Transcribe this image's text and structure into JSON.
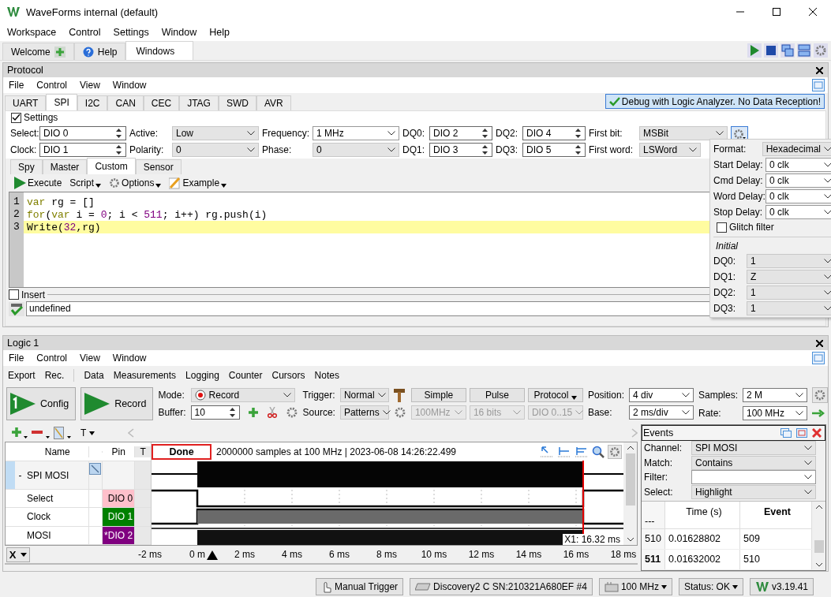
{
  "window": {
    "title": "WaveForms internal (default)"
  },
  "menu": [
    "Workspace",
    "Control",
    "Settings",
    "Window",
    "Help"
  ],
  "workspace_tabs": [
    {
      "label": "Welcome",
      "selected": false,
      "kind": "add"
    },
    {
      "label": "Help",
      "selected": false,
      "kind": "help"
    },
    {
      "label": "Windows",
      "selected": true,
      "kind": "plain"
    }
  ],
  "protocol": {
    "title": "Protocol",
    "menu": [
      "File",
      "Control",
      "View",
      "Window"
    ],
    "tabs": [
      {
        "label": "UART",
        "selected": false
      },
      {
        "label": "SPI",
        "selected": true
      },
      {
        "label": "I2C",
        "selected": false
      },
      {
        "label": "CAN",
        "selected": false
      },
      {
        "label": "CEC",
        "selected": false
      },
      {
        "label": "JTAG",
        "selected": false
      },
      {
        "label": "SWD",
        "selected": false
      },
      {
        "label": "AVR",
        "selected": false
      }
    ],
    "notice": "Debug with Logic Analyzer. No Data Reception!",
    "settings": {
      "label": "Settings",
      "checked": true,
      "columns": [
        [
          {
            "label": "Select:",
            "value": "DIO 0",
            "kind": "spin"
          },
          {
            "label": "Clock:",
            "value": "DIO 1",
            "kind": "spin"
          }
        ],
        [
          {
            "label": "Active:",
            "value": "Low",
            "kind": "list"
          },
          {
            "label": "Polarity:",
            "value": "0",
            "kind": "list"
          }
        ],
        [
          {
            "label": "Frequency:",
            "value": "1 MHz",
            "kind": "combo"
          },
          {
            "label": "Phase:",
            "value": "0",
            "kind": "list"
          }
        ],
        [
          {
            "label": "DQ0:",
            "value": "DIO 2",
            "kind": "spin"
          },
          {
            "label": "DQ1:",
            "value": "DIO 3",
            "kind": "spin"
          }
        ],
        [
          {
            "label": "DQ2:",
            "value": "DIO 4",
            "kind": "spin"
          },
          {
            "label": "DQ3:",
            "value": "DIO 5",
            "kind": "spin"
          }
        ],
        [
          {
            "label": "First bit:",
            "value": "MSBit",
            "kind": "list"
          },
          {
            "label": "First word:",
            "value": "LSWord",
            "kind": "list"
          }
        ]
      ]
    },
    "subtabs": [
      {
        "label": "Spy",
        "selected": false
      },
      {
        "label": "Master",
        "selected": false
      },
      {
        "label": "Custom",
        "selected": true
      },
      {
        "label": "Sensor",
        "selected": false
      }
    ],
    "toolbar": [
      {
        "label": "Execute",
        "kind": "run"
      },
      {
        "label": "Script",
        "kind": "menu"
      },
      {
        "label": "Options",
        "kind": "gear"
      },
      {
        "label": "Example",
        "kind": "pencil"
      }
    ],
    "code": [
      {
        "number": "1",
        "current": false,
        "tokens": [
          {
            "text": "var",
            "kind": "keyword"
          },
          {
            "text": " rg = []",
            "kind": "plain"
          }
        ]
      },
      {
        "number": "2",
        "current": false,
        "tokens": [
          {
            "text": "for",
            "kind": "keyword"
          },
          {
            "text": "(",
            "kind": "plain"
          },
          {
            "text": "var",
            "kind": "keyword"
          },
          {
            "text": " i = ",
            "kind": "plain"
          },
          {
            "text": "0",
            "kind": "number"
          },
          {
            "text": "; i < ",
            "kind": "plain"
          },
          {
            "text": "511",
            "kind": "number"
          },
          {
            "text": "; i++) rg.push(i)",
            "kind": "plain"
          }
        ]
      },
      {
        "number": "3",
        "current": true,
        "tokens": [
          {
            "text": "Write(",
            "kind": "plain"
          },
          {
            "text": "32",
            "kind": "number"
          },
          {
            "text": ",rg)",
            "kind": "plain"
          }
        ]
      }
    ],
    "insert": {
      "label": "Insert",
      "checked": false
    },
    "output": {
      "value": "undefined"
    },
    "popup": {
      "rows": [
        {
          "label": "Format:",
          "value": "Hexadecimal",
          "kind": "list"
        },
        {
          "label": "Start Delay:",
          "value": "0 clk",
          "kind": "combo"
        },
        {
          "label": "Cmd Delay:",
          "value": "0 clk",
          "kind": "combo"
        },
        {
          "label": "Word Delay:",
          "value": "0 clk",
          "kind": "combo"
        },
        {
          "label": "Stop Delay:",
          "value": "0 clk",
          "kind": "combo"
        }
      ],
      "glitch": {
        "label": "Glitch filter",
        "checked": false
      },
      "initial_label": "Initial",
      "initial": [
        {
          "label": "DQ0:",
          "value": "1"
        },
        {
          "label": "DQ1:",
          "value": "Z"
        },
        {
          "label": "DQ2:",
          "value": "1"
        },
        {
          "label": "DQ3:",
          "value": "1"
        }
      ]
    }
  },
  "logic": {
    "title": "Logic 1",
    "menu": [
      "File",
      "Control",
      "View",
      "Window"
    ],
    "toolbar": [
      [
        "Export",
        "Rec."
      ],
      [
        "Data",
        "Measurements",
        "Logging",
        "Counter",
        "Cursors",
        "Notes"
      ]
    ],
    "run_buttons": [
      {
        "label": "Config",
        "kind": "config"
      },
      {
        "label": "Record",
        "kind": "record"
      }
    ],
    "mode": {
      "label": "Mode:",
      "value": "Record"
    },
    "buffer": {
      "label": "Buffer:",
      "value": "10"
    },
    "trigger": {
      "label": "Trigger:",
      "value": "Normal"
    },
    "source": {
      "label": "Source:",
      "value": "Patterns"
    },
    "trigger_buttons": [
      {
        "label": "Simple",
        "kind": "plain"
      },
      {
        "label": "Pulse",
        "kind": "plain"
      },
      {
        "label": "Protocol",
        "kind": "menu"
      }
    ],
    "trigger_fields": [
      {
        "value": "100MHz",
        "disabled": true
      },
      {
        "value": "16 bits",
        "disabled": true
      },
      {
        "value": "DIO 0..15",
        "disabled": true
      }
    ],
    "timebase": [
      [
        {
          "label": "Position:",
          "value": "4 div"
        },
        {
          "label": "Base:",
          "value": "2 ms/div"
        }
      ],
      [
        {
          "label": "Samples:",
          "value": "2 M"
        },
        {
          "label": "Rate:",
          "value": "100 MHz"
        }
      ]
    ],
    "signal_tools": [
      "T"
    ],
    "header": {
      "name": "Name",
      "pin": "Pin",
      "t": "T",
      "status": "Done",
      "info": "2000000 samples at 100 MHz | 2023-06-08 14:26:22.499"
    },
    "signals": [
      {
        "toggle": "-",
        "name": "SPI MOSI",
        "kind": "bus",
        "selected": true
      },
      {
        "name": "Select",
        "pin": "DIO 0",
        "color": "#ffc0cb",
        "kind": "signal",
        "selected": false
      },
      {
        "name": "Clock",
        "pin": "DIO 1",
        "color": "#008000",
        "kind": "signal",
        "selected": false
      },
      {
        "name": "MOSI",
        "pin": "*DIO 2",
        "color": "#800080",
        "kind": "signal",
        "selected": false
      }
    ],
    "axis": {
      "label": "X",
      "ticks": [
        "-2 ms",
        "0 m",
        "2 ms",
        "4 ms",
        "6 ms",
        "8 ms",
        "10 ms",
        "12 ms",
        "14 ms",
        "16 ms",
        "18 ms"
      ],
      "cursor": "X1: 16.32 ms"
    },
    "events": {
      "title": "Events",
      "filters": [
        {
          "label": "Channel:",
          "value": "SPI MOSI",
          "kind": "list"
        },
        {
          "label": "Match:",
          "value": "Contains",
          "kind": "list"
        },
        {
          "label": "Filter:",
          "kind": "combo"
        },
        {
          "label": "Select:",
          "value": "Highlight",
          "kind": "list"
        }
      ],
      "columns": [
        {
          "label": "---",
          "sorted": false
        },
        {
          "label": "Time (s)",
          "sorted": false
        },
        {
          "label": "Event",
          "sorted": true
        }
      ],
      "rows": [
        {
          "index": "510",
          "time": "0.01628802",
          "event": "509",
          "selected": false
        },
        {
          "index": "511",
          "time": "0.01632002",
          "event": "510",
          "selected": true
        }
      ]
    }
  },
  "status_bar": [
    {
      "label": "Manual Trigger",
      "kind": "hand"
    },
    {
      "label": "Discovery2 C SN:210321A680EF #4",
      "kind": "device"
    },
    {
      "label": "100 MHz",
      "kind": "clock"
    },
    {
      "label": "Status: OK",
      "kind": "menu"
    },
    {
      "label": "v3.19.41",
      "kind": "logo"
    }
  ]
}
